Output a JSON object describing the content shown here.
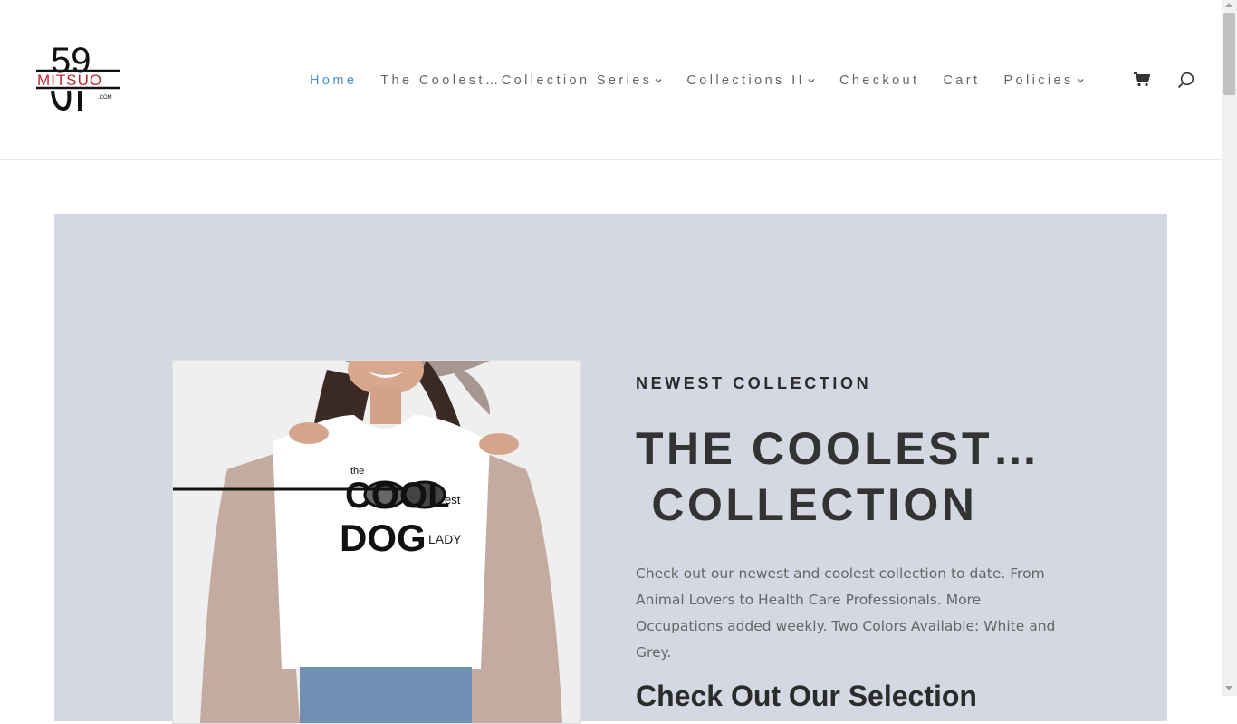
{
  "header": {
    "logo": {
      "number": "59",
      "name": "MITSUO",
      "suffix": ".COM"
    },
    "nav": [
      {
        "label": "Home",
        "active": true,
        "has_dropdown": false
      },
      {
        "label": "The Coolest…Collection Series",
        "active": false,
        "has_dropdown": true
      },
      {
        "label": "Collections II",
        "active": false,
        "has_dropdown": true
      },
      {
        "label": "Checkout",
        "active": false,
        "has_dropdown": false
      },
      {
        "label": "Cart",
        "active": false,
        "has_dropdown": false
      },
      {
        "label": "Policies",
        "active": false,
        "has_dropdown": true
      }
    ],
    "icons": [
      "cart-icon",
      "search-icon"
    ]
  },
  "hero": {
    "kicker": "NEWEST COLLECTION",
    "title_line1": "THE COOLEST…",
    "title_line2": " COLLECTION",
    "body": "Check out our newest and coolest collection to date. From Animal Lovers to Health Care Professionals. More Occupations added weekly. Two Colors Available: White and Grey.",
    "subhead": "Check Out Our Selection",
    "shirt_graphic": {
      "line1": "the",
      "cool": "COOL",
      "est": "est",
      "dog": "DOG",
      "lady": "LADY"
    }
  },
  "colors": {
    "hero_bg": "#d4d8e2",
    "nav_active": "#4a90c6",
    "nav_text": "#666666",
    "logo_red": "#c0262d"
  }
}
